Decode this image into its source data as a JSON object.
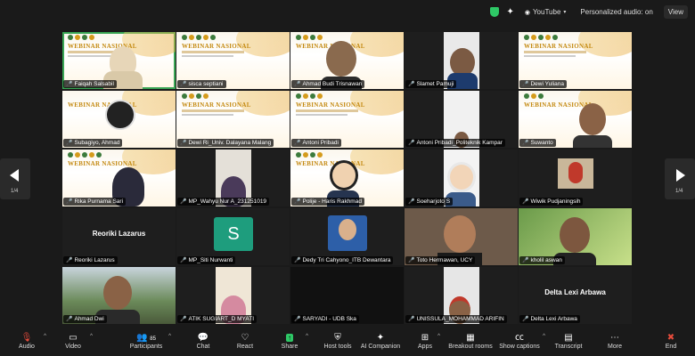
{
  "topbar": {
    "youtube_label": "YouTube",
    "personalized_audio": "Personalized audio: on",
    "view_label": "View",
    "icons": [
      "shield-icon",
      "sparkle-icon"
    ]
  },
  "grid": {
    "page_left": "1/4",
    "page_right": "1/4",
    "webinar_title": "WEBINAR NASIONAL",
    "participants": [
      {
        "name": "Faiqah Salsabil"
      },
      {
        "name": "sisca septiani"
      },
      {
        "name": "Ahmad Budi Trisnawan"
      },
      {
        "name": "Slamet Pamuji"
      },
      {
        "name": "Dewi Yuliana"
      },
      {
        "name": "Subagiyo, Ahmad"
      },
      {
        "name": "Dewi Ri_Univ. Dalayana Malang"
      },
      {
        "name": "Antoni Pribadi"
      },
      {
        "name": "Antoni Pribadi_Politeknik Kampar"
      },
      {
        "name": "Suwanto"
      },
      {
        "name": "Rika Purnama Sari"
      },
      {
        "name": "MP_Wahyu Nur A_231251019"
      },
      {
        "name": "Polije - Haris Rakhmad"
      },
      {
        "name": "Soeharjoto S"
      },
      {
        "name": "Wiwik Pudjaningsih"
      },
      {
        "name": "Reoriki Lazarus",
        "center": "Reoriki Lazarus"
      },
      {
        "name": "MP_Siti Nurwanti",
        "initial": "S"
      },
      {
        "name": "Dedy Tri Cahyono_ITB Dewantara"
      },
      {
        "name": "Toto Hermawan, UCY"
      },
      {
        "name": "kholil aswan"
      },
      {
        "name": "Ahmad Dwi"
      },
      {
        "name": "ATIK SUGIART_D MYATI"
      },
      {
        "name": "SARYADI - UDB Ska"
      },
      {
        "name": "UNISSULA_MOHAMMAD ARIFIN"
      },
      {
        "name": "Delta Lexi Arbawa",
        "center": "Delta Lexi Arbawa"
      }
    ]
  },
  "toolbar": {
    "audio": "Audio",
    "video": "Video",
    "participants": "Participants",
    "participants_count": "85",
    "chat": "Chat",
    "react": "React",
    "share": "Share",
    "host_tools": "Host tools",
    "ai_companion": "AI Companion",
    "apps": "Apps",
    "breakout_rooms": "Breakout rooms",
    "show_captions": "Show captions",
    "transcript": "Transcript",
    "more": "More",
    "end": "End"
  }
}
